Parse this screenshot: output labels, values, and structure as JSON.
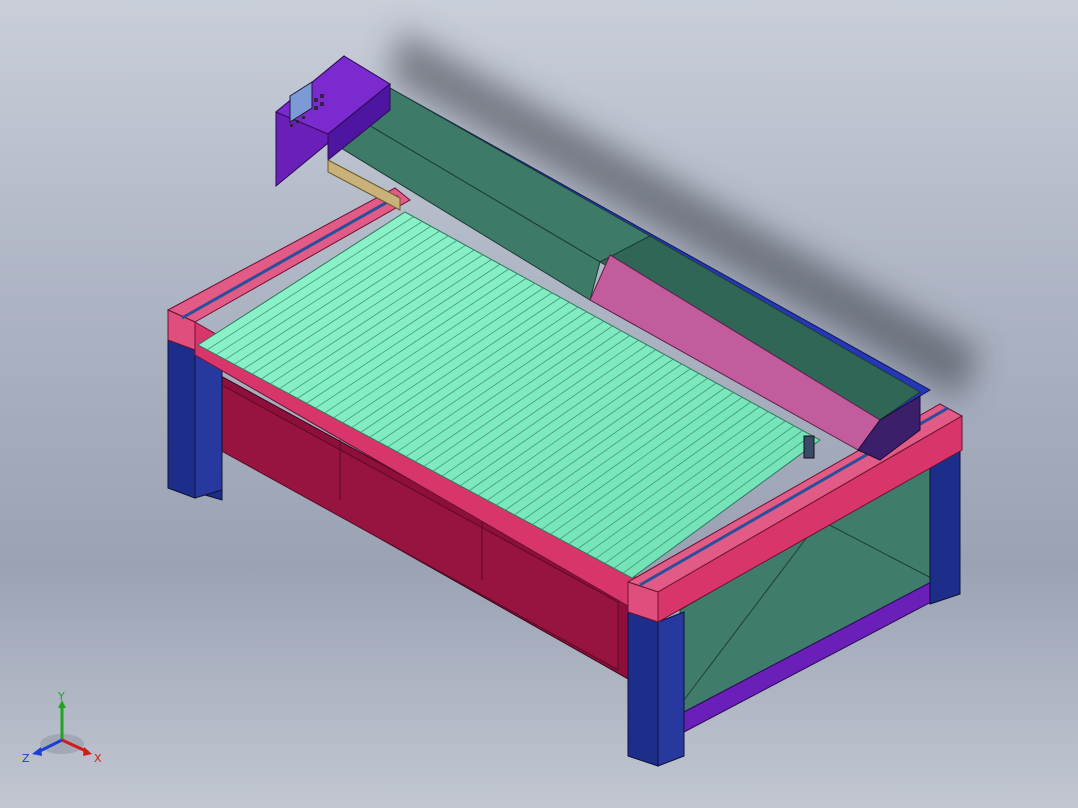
{
  "viewport": {
    "background_top": "#c9ced9",
    "background_bottom": "#9aa2b4"
  },
  "model": {
    "colors": {
      "bed_slats": "#86f2c7",
      "frame_red": "#e25a86",
      "frame_dark_red": "#8e0f3c",
      "legs_navy": "#1d2d8a",
      "gantry_green": "#3d7a68",
      "gantry_blue": "#2536b8",
      "gantry_pink": "#c25c9c",
      "control_box_purple": "#6a1fb8",
      "enclosure_teal": "#3f7c6c"
    },
    "parts": [
      "control-panel",
      "gantry-beam",
      "cutting-bed",
      "front-frame",
      "side-frame",
      "legs",
      "base-enclosure"
    ]
  },
  "triad": {
    "x_label": "X",
    "y_label": "Y",
    "z_label": "Z",
    "x_color": "#d11b1b",
    "y_color": "#22a322",
    "z_color": "#1b3fd1"
  }
}
